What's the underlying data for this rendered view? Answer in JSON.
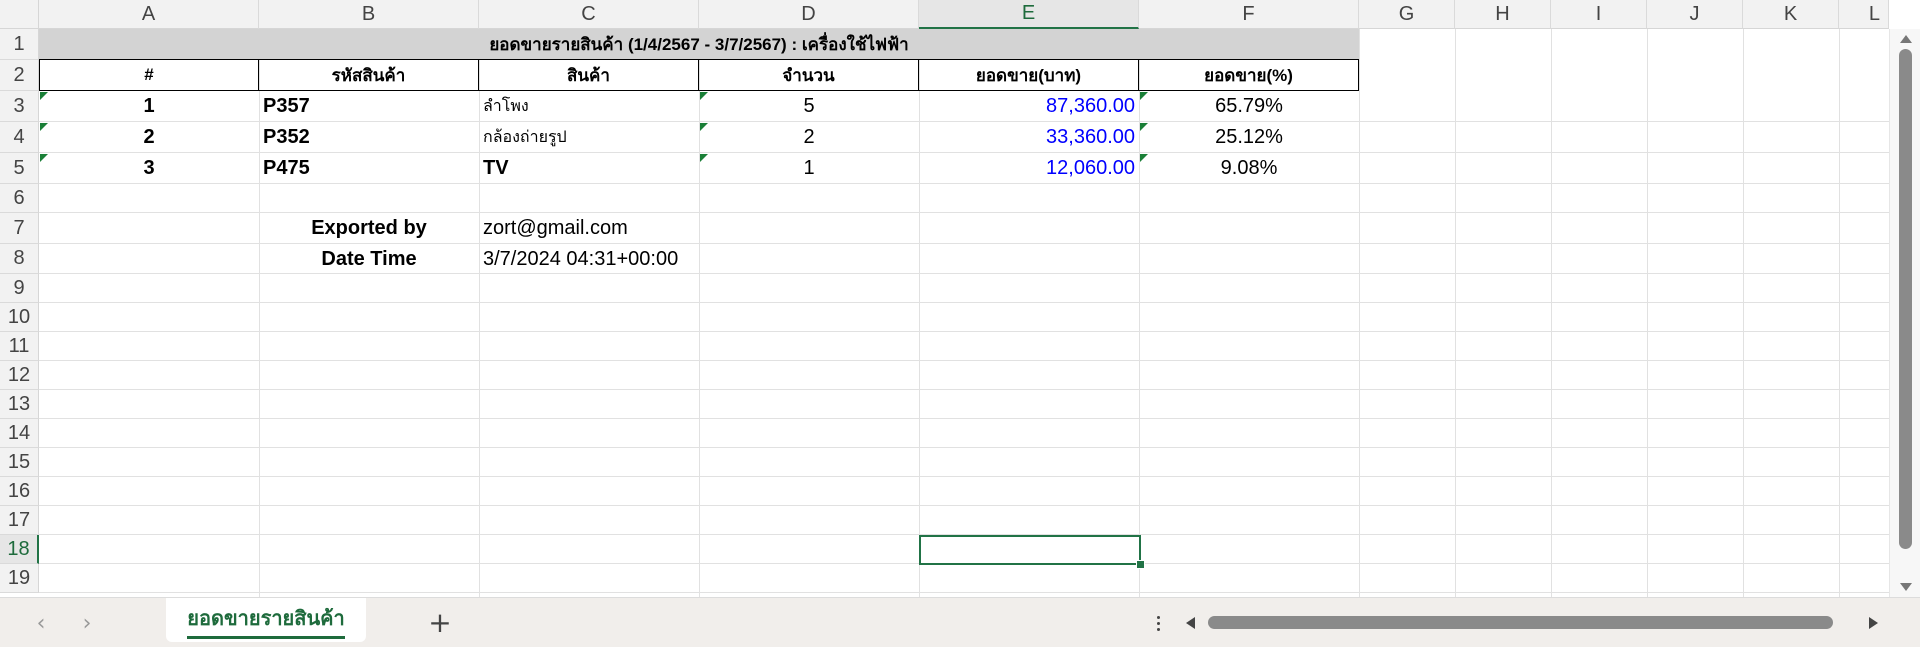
{
  "columns": [
    "A",
    "B",
    "C",
    "D",
    "E",
    "F",
    "G",
    "H",
    "I",
    "J",
    "K",
    "L"
  ],
  "rows": [
    "1",
    "2",
    "3",
    "4",
    "5",
    "6",
    "7",
    "8",
    "9",
    "10",
    "11",
    "12",
    "13",
    "14",
    "15",
    "16",
    "17",
    "18",
    "19"
  ],
  "active_cell": {
    "column": "E",
    "row": "18"
  },
  "sheet": {
    "title": "ยอดขายรายสินค้า (1/4/2567 - 3/7/2567) : เครื่องใช้ไฟฟ้า",
    "headers": {
      "no": "#",
      "code": "รหัสสินค้า",
      "product": "สินค้า",
      "qty": "จำนวน",
      "sales": "ยอดขาย(บาท)",
      "percent": "ยอดขาย(%)"
    },
    "data_rows": [
      {
        "no": "1",
        "code": "P357",
        "product": "ลำโพง",
        "qty": "5",
        "sales": "87,360.00",
        "percent": "65.79%"
      },
      {
        "no": "2",
        "code": "P352",
        "product": "กล้องถ่ายรูป",
        "qty": "2",
        "sales": "33,360.00",
        "percent": "25.12%"
      },
      {
        "no": "3",
        "code": "P475",
        "product": "TV",
        "qty": "1",
        "sales": "12,060.00",
        "percent": "9.08%"
      }
    ],
    "exported_by_label": "Exported by",
    "exported_by_value": "zort@gmail.com",
    "datetime_label": "Date Time",
    "datetime_value": "3/7/2024 04:31+00:00"
  },
  "tabs": [
    {
      "label": "ยอดขายรายสินค้า",
      "active": true
    }
  ],
  "add_sheet_label": "+",
  "colors": {
    "accent": "#217346",
    "sales_text": "#0000ff",
    "title_band": "#d3d3d3"
  }
}
